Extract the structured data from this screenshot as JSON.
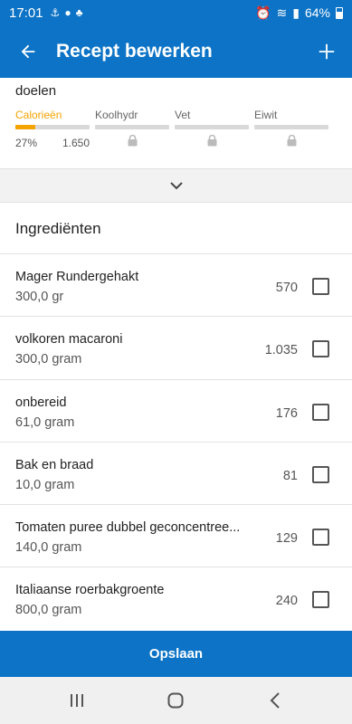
{
  "status": {
    "time": "17:01",
    "battery": "64%"
  },
  "header": {
    "title": "Recept bewerken"
  },
  "goals": {
    "label": "doelen",
    "macros": [
      {
        "label": "Calorieën",
        "percent": "27%",
        "value": "1.650",
        "progress": 0.27,
        "locked": false,
        "active": true
      },
      {
        "label": "Koolhydr",
        "locked": true,
        "active": false
      },
      {
        "label": "Vet",
        "locked": true,
        "active": false
      },
      {
        "label": "Eiwit",
        "locked": true,
        "active": false
      }
    ]
  },
  "ingredients": {
    "title": "Ingrediënten",
    "items": [
      {
        "name": "Mager Rundergehakt",
        "qty": "300,0 gr",
        "calories": "570",
        "checked": false
      },
      {
        "name": "volkoren macaroni",
        "qty": "300,0 gram",
        "calories": "1.035",
        "checked": false
      },
      {
        "name": "onbereid",
        "qty": "61,0 gram",
        "calories": "176",
        "checked": false
      },
      {
        "name": "Bak en braad",
        "qty": "10,0 gram",
        "calories": "81",
        "checked": false
      },
      {
        "name": "Tomaten puree dubbel geconcentree...",
        "qty": "140,0 gram",
        "calories": "129",
        "checked": false
      },
      {
        "name": "Italiaanse roerbakgroente",
        "qty": "800,0 gram",
        "calories": "240",
        "checked": false
      }
    ]
  },
  "footer": {
    "save_label": "Opslaan"
  },
  "colors": {
    "primary": "#0c73c6",
    "accent": "#f4a300"
  }
}
